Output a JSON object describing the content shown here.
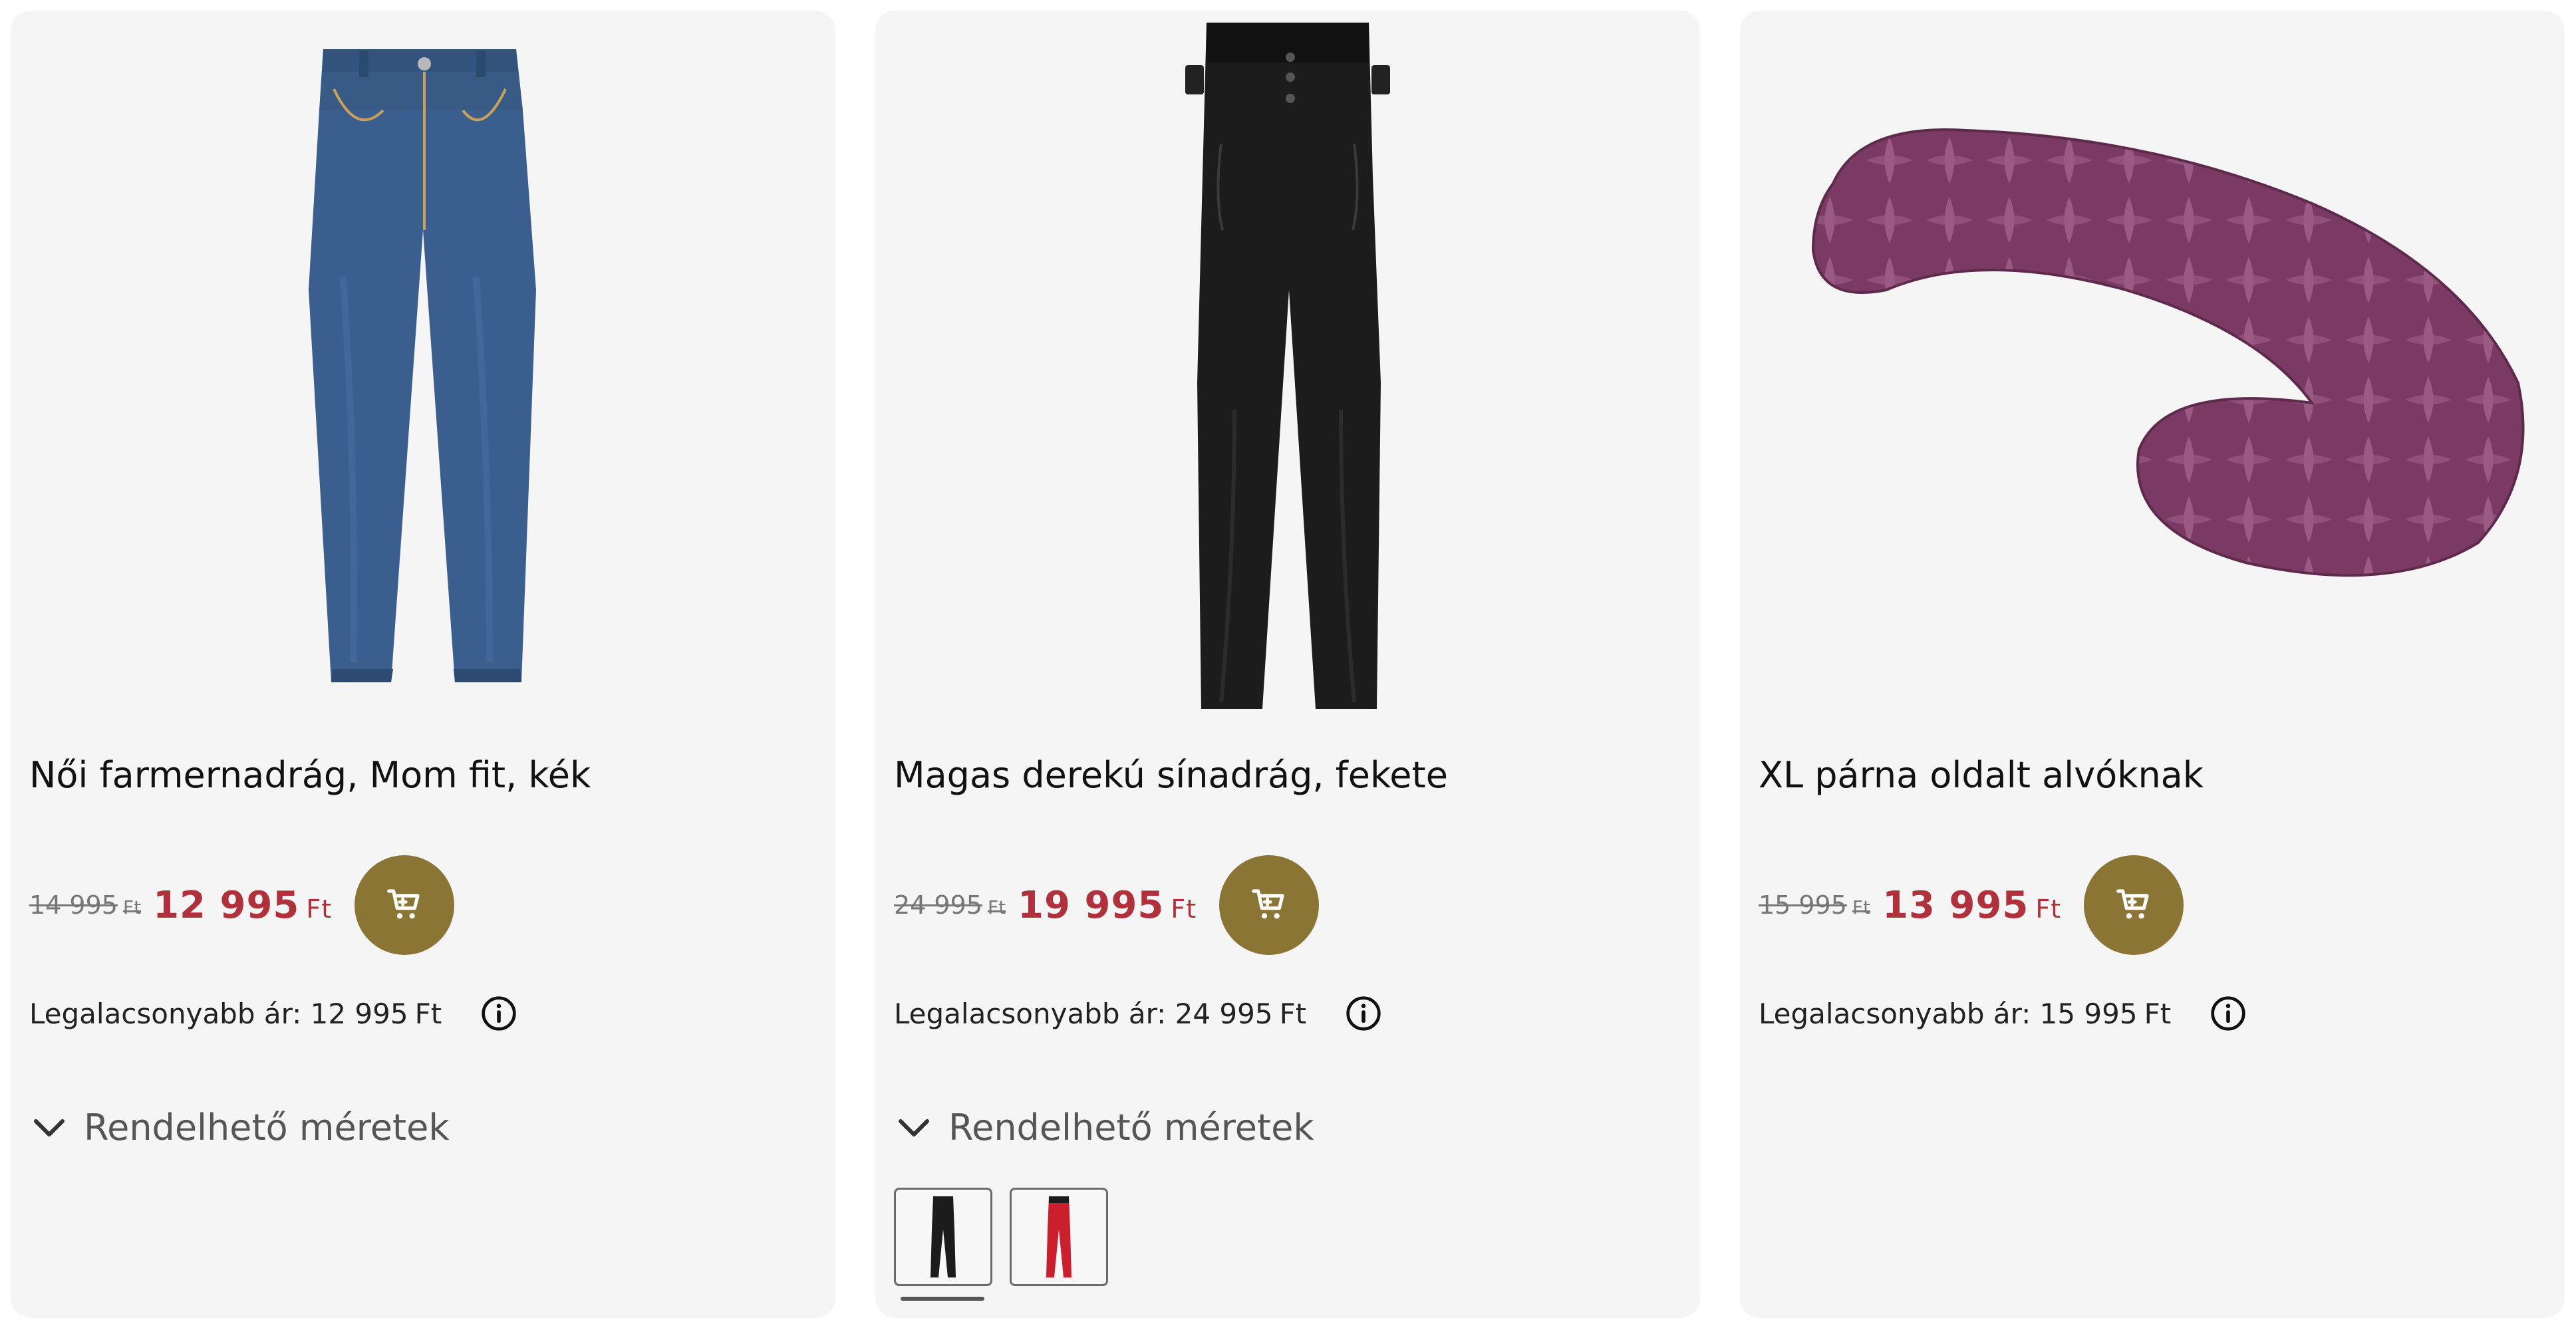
{
  "currency": "Ft",
  "colors": {
    "card_bg": "#f5f5f5",
    "sale_price": "#b0313b",
    "cart_button": "#8a7535"
  },
  "products": [
    {
      "title": "Női farmernadrág, Mom fit, kék",
      "image": "blue-mom-fit-jeans",
      "old_price": "14 995",
      "new_price": "12 995",
      "lowest_label": "Legalacsonyabb ár:",
      "lowest_price": "12 995",
      "sizes_label": "Rendelhető méretek",
      "cart_icon": "shopping-cart-icon",
      "info_icon": "info-icon"
    },
    {
      "title": "Magas derekú sínadrág, fekete",
      "image": "black-high-waist-ski-pants",
      "old_price": "24 995",
      "new_price": "19 995",
      "lowest_label": "Legalacsonyabb ár:",
      "lowest_price": "24 995",
      "sizes_label": "Rendelhető méretek",
      "cart_icon": "shopping-cart-icon",
      "info_icon": "info-icon",
      "color_swatches": [
        {
          "color": "black",
          "selected": true
        },
        {
          "color": "red",
          "selected": false
        }
      ]
    },
    {
      "title": "XL párna oldalt alvóknak",
      "image": "purple-side-sleeper-pillow",
      "old_price": "15 995",
      "new_price": "13 995",
      "lowest_label": "Legalacsonyabb ár:",
      "lowest_price": "15 995",
      "cart_icon": "shopping-cart-icon",
      "info_icon": "info-icon"
    }
  ]
}
